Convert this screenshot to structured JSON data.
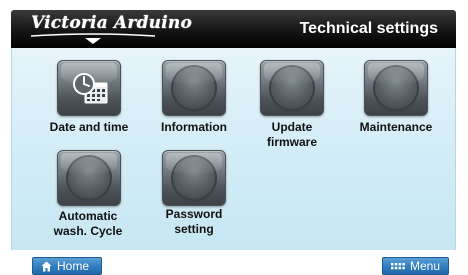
{
  "header": {
    "brand": "Victoria Arduino",
    "title": "Technical settings"
  },
  "tiles": [
    {
      "label": "Date and time",
      "icon": "calendar-clock-icon"
    },
    {
      "label": "Information",
      "icon": "round-button-icon"
    },
    {
      "label": "Update firmware",
      "label_lines": [
        "Update",
        "firmware"
      ],
      "icon": "round-button-icon"
    },
    {
      "label": "Maintenance",
      "icon": "round-button-icon"
    },
    {
      "label": "Automatic wash. Cycle",
      "label_lines": [
        "Automatic",
        "wash. Cycle"
      ],
      "icon": "round-button-icon"
    },
    {
      "label": "Password setting",
      "label_lines": [
        "Password",
        "setting"
      ],
      "icon": "round-button-icon"
    }
  ],
  "footer": {
    "home_label": "Home",
    "home_icon": "home-icon",
    "menu_label": "Menu",
    "menu_icon": "menu-grid-icon"
  },
  "colors": {
    "header_bg": "#111111",
    "content_bg": "#d3edf7",
    "button_blue": "#2f7cc0"
  }
}
